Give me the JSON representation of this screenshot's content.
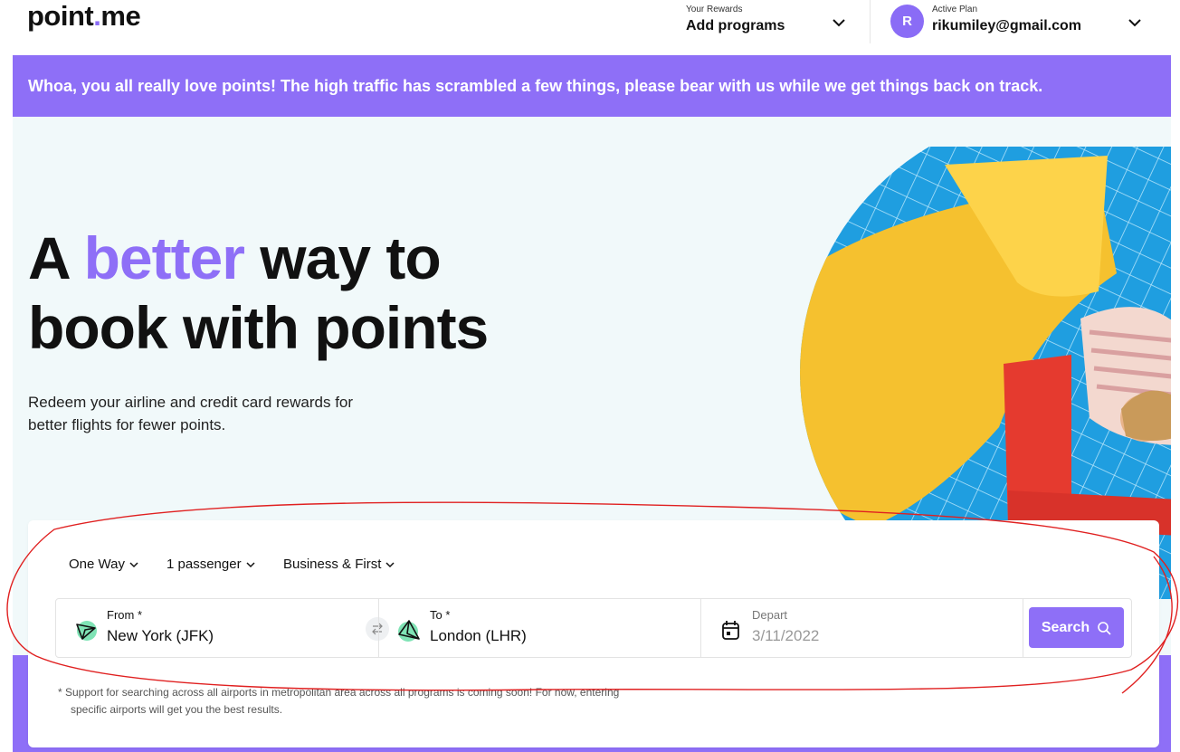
{
  "header": {
    "logo": {
      "part1": "point",
      "dot": ".",
      "part2": "me"
    },
    "rewards": {
      "label": "Your Rewards",
      "value": "Add programs"
    },
    "account": {
      "avatar_initial": "R",
      "label": "Active Plan",
      "email": "rikumiley@gmail.com"
    }
  },
  "banner": {
    "text": "Whoa, you all really love points! The high traffic has scrambled a few things, please bear with us while we get things back on track."
  },
  "hero": {
    "headline_part1": "A ",
    "headline_accent": "better",
    "headline_part2": " way to",
    "headline_line2": "book with points",
    "subtext": "Redeem your airline and credit card rewards for better flights for fewer points."
  },
  "search": {
    "trip_type": "One Way",
    "passengers": "1 passenger",
    "cabin": "Business & First",
    "from": {
      "label": "From *",
      "value": "New York (JFK)"
    },
    "to": {
      "label": "To *",
      "value": "London (LHR)"
    },
    "depart": {
      "label": "Depart",
      "value": "3/11/2022"
    },
    "search_label": "Search",
    "note": "*  Support for searching across all airports in metropolitan area across all programs is coming soon! For now, entering specific airports will get you the best results."
  },
  "colors": {
    "accent": "#8e6ff7",
    "hero_bg": "#f1f9fa",
    "icon_green": "#7fe3b5",
    "annotation": "#e02020"
  }
}
